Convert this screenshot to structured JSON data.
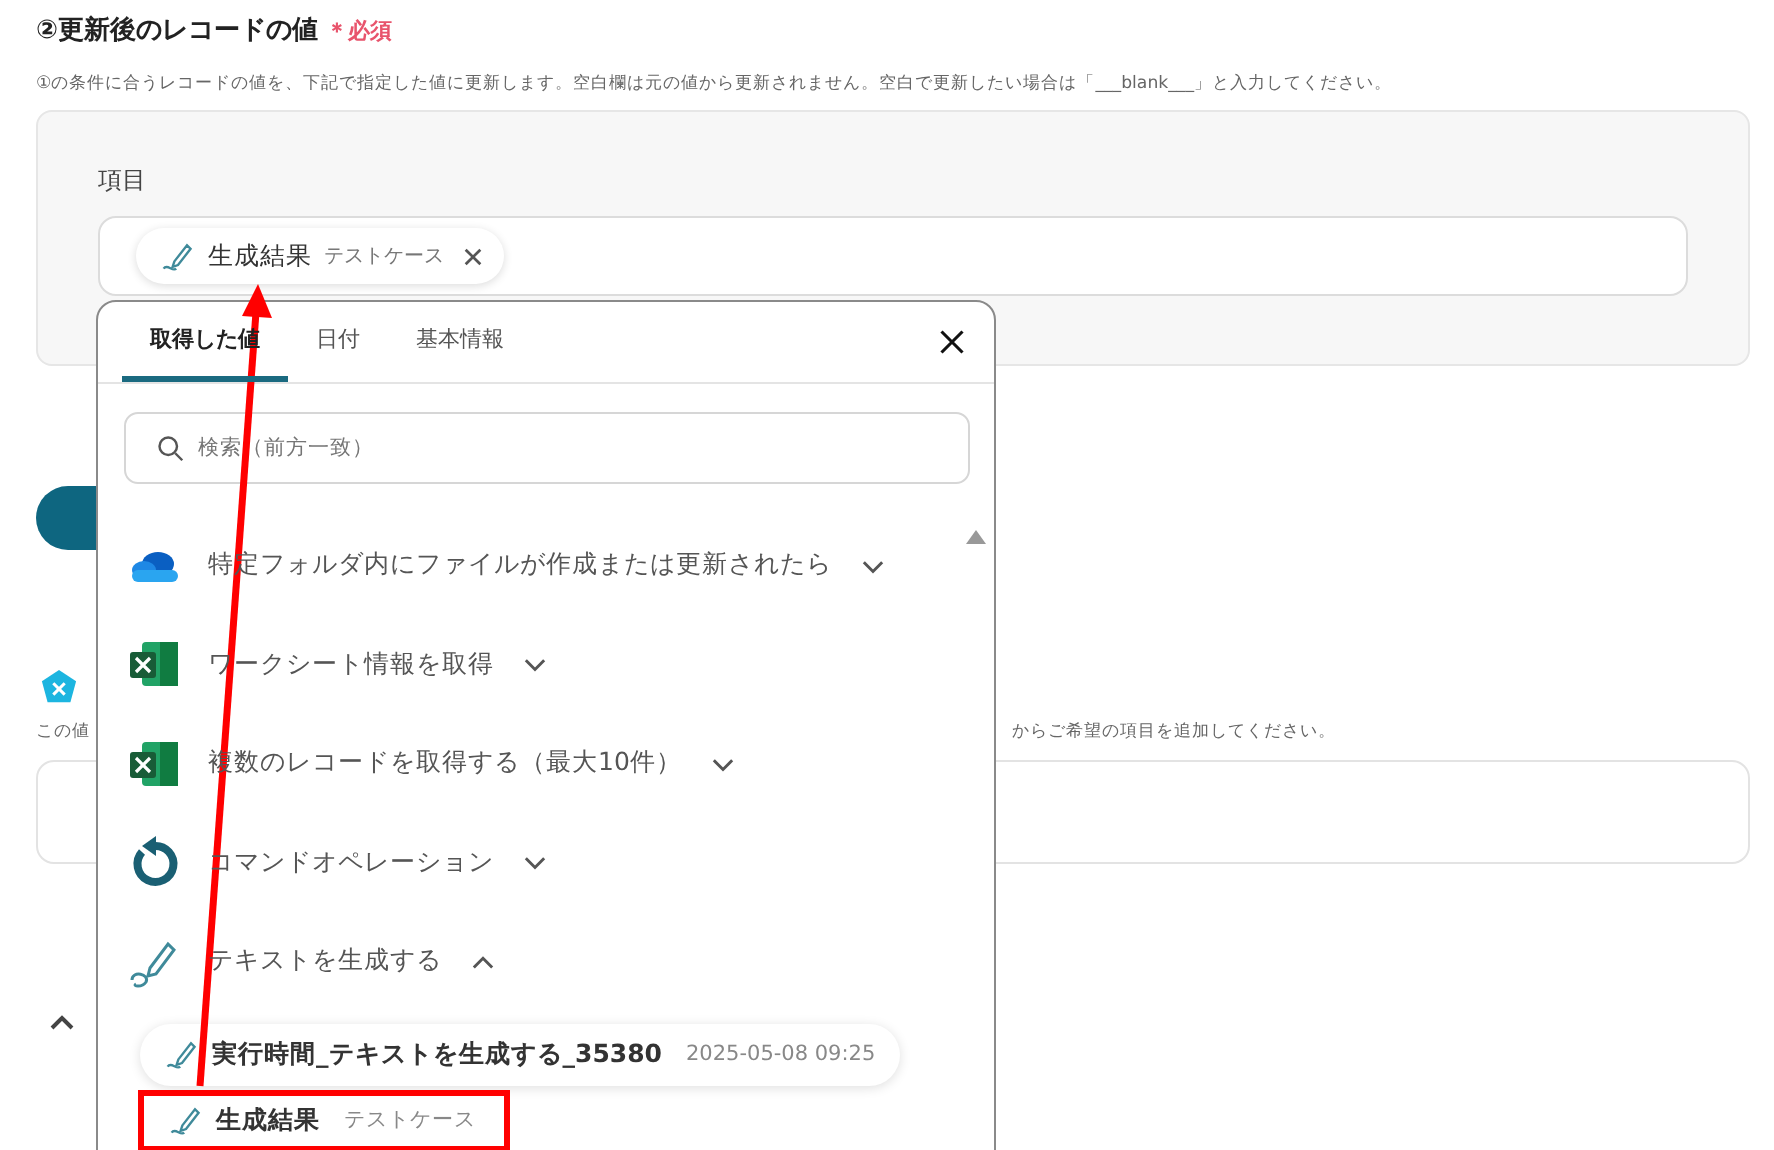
{
  "section": {
    "title": "②更新後のレコードの値",
    "required": "＊必須",
    "description": "①の条件に合うレコードの値を、下記で指定した値に更新します。空白欄は元の値から更新されません。空白で更新したい場合は「___blank___」と入力してください。"
  },
  "field": {
    "label": "項目",
    "chip": {
      "name": "生成結果",
      "value": "テストケース"
    }
  },
  "background": {
    "description_start": "この値",
    "description_end": "からご希望の項目を追加してください。"
  },
  "popup": {
    "tabs": [
      {
        "label": "取得した値",
        "selected": true
      },
      {
        "label": "日付",
        "selected": false
      },
      {
        "label": "基本情報",
        "selected": false
      }
    ],
    "search": {
      "placeholder": "検索（前方一致）"
    },
    "groups": [
      {
        "label": "特定フォルダ内にファイルが作成または更新されたら",
        "kind": "cloud",
        "expanded": false
      },
      {
        "label": "ワークシート情報を取得",
        "kind": "sheet",
        "expanded": false
      },
      {
        "label": "複数のレコードを取得する（最大10件）",
        "kind": "sheet",
        "expanded": false
      },
      {
        "label": "コマンドオペレーション",
        "kind": "loop",
        "expanded": false
      },
      {
        "label": "テキストを生成する",
        "kind": "pen",
        "expanded": true
      }
    ],
    "outputs": [
      {
        "name": "実行時間_テキストを生成する_35380",
        "value": "2025-05-08 09:25",
        "highlighted": false
      },
      {
        "name": "生成結果",
        "value": "テストケース",
        "highlighted": true
      }
    ]
  }
}
